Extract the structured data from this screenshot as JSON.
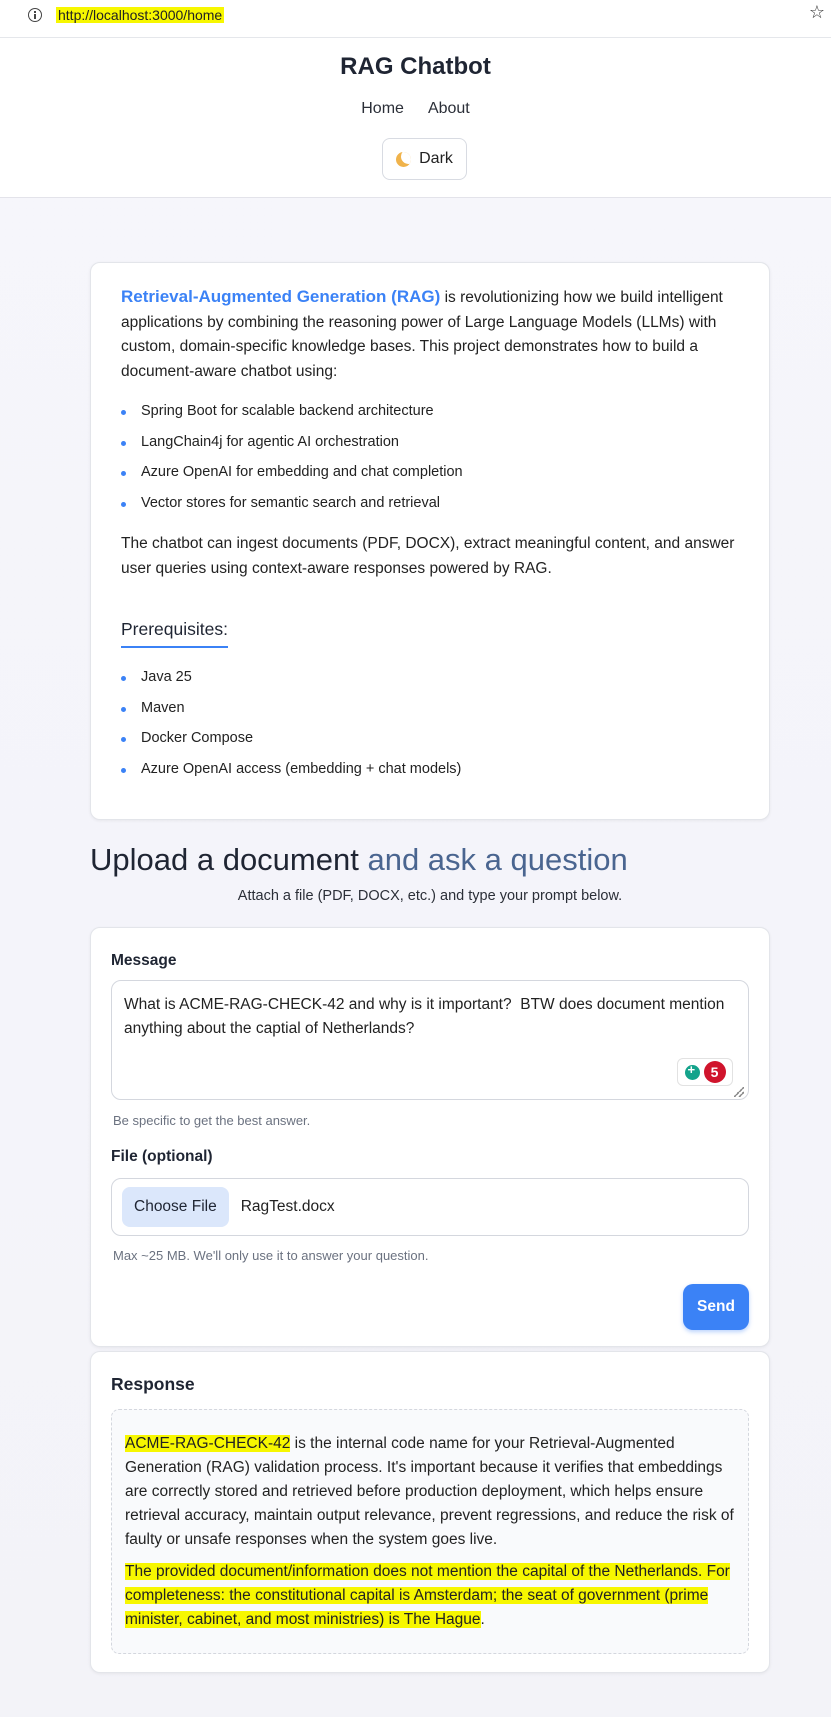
{
  "browser": {
    "url": "http://localhost:3000/home"
  },
  "header": {
    "title": "RAG Chatbot",
    "nav": [
      {
        "label": "Home"
      },
      {
        "label": "About"
      }
    ],
    "theme_toggle_label": "Dark"
  },
  "intro": {
    "highlight": "Retrieval-Augmented Generation (RAG)",
    "paragraph1_rest": " is revolutionizing how we build intelligent applications by combining the reasoning power of Large Language Models (LLMs) with custom, domain-specific knowledge bases. This project demonstrates how to build a document-aware chatbot using:",
    "features": [
      "Spring Boot for scalable backend architecture",
      "LangChain4j for agentic AI orchestration",
      "Azure OpenAI for embedding and chat completion",
      "Vector stores for semantic search and retrieval"
    ],
    "paragraph2": "The chatbot can ingest documents (PDF, DOCX), extract meaningful content, and answer user queries using context-aware responses powered by RAG.",
    "prereq_title": "Prerequisites:",
    "prerequisites": [
      "Java 25",
      "Maven",
      "Docker Compose",
      "Azure OpenAI access (embedding + chat models)"
    ]
  },
  "upload": {
    "title_part1": "Upload a document",
    "title_part2": " and ",
    "title_part3": "ask a question",
    "subtitle": "Attach a file (PDF, DOCX, etc.) and type your prompt below."
  },
  "form": {
    "message_label": "Message",
    "message_value": "What is ACME-RAG-CHECK-42 and why is it important?  BTW does document mention anything about the captial of Netherlands?",
    "extension_count": "5",
    "message_hint": "Be specific to get the best answer.",
    "file_label": "File (optional)",
    "choose_file_label": "Choose File",
    "file_name": "RagTest.docx",
    "file_hint": "Max ~25 MB. We'll only use it to answer your question.",
    "send_label": "Send"
  },
  "response": {
    "title": "Response",
    "p1_highlight": "ACME-RAG-CHECK-42",
    "p1_rest": " is the internal code name for your Retrieval-Augmented Generation (RAG) validation process. It's important because it verifies that embeddings are correctly stored and retrieved before production deployment, which helps ensure retrieval accuracy, maintain output relevance, prevent regressions, and reduce the risk of faulty or unsafe responses when the system goes live.",
    "p2_highlight": "The provided document/information does not mention the capital of the Netherlands. For completeness: the constitutional capital is Amsterdam; the seat of government (prime minister, cabinet, and most ministries) is The Hague",
    "p2_tail": "."
  },
  "colors": {
    "accent": "#3b82f6",
    "highlight": "#f7f700",
    "badge_red": "#d0142c"
  }
}
